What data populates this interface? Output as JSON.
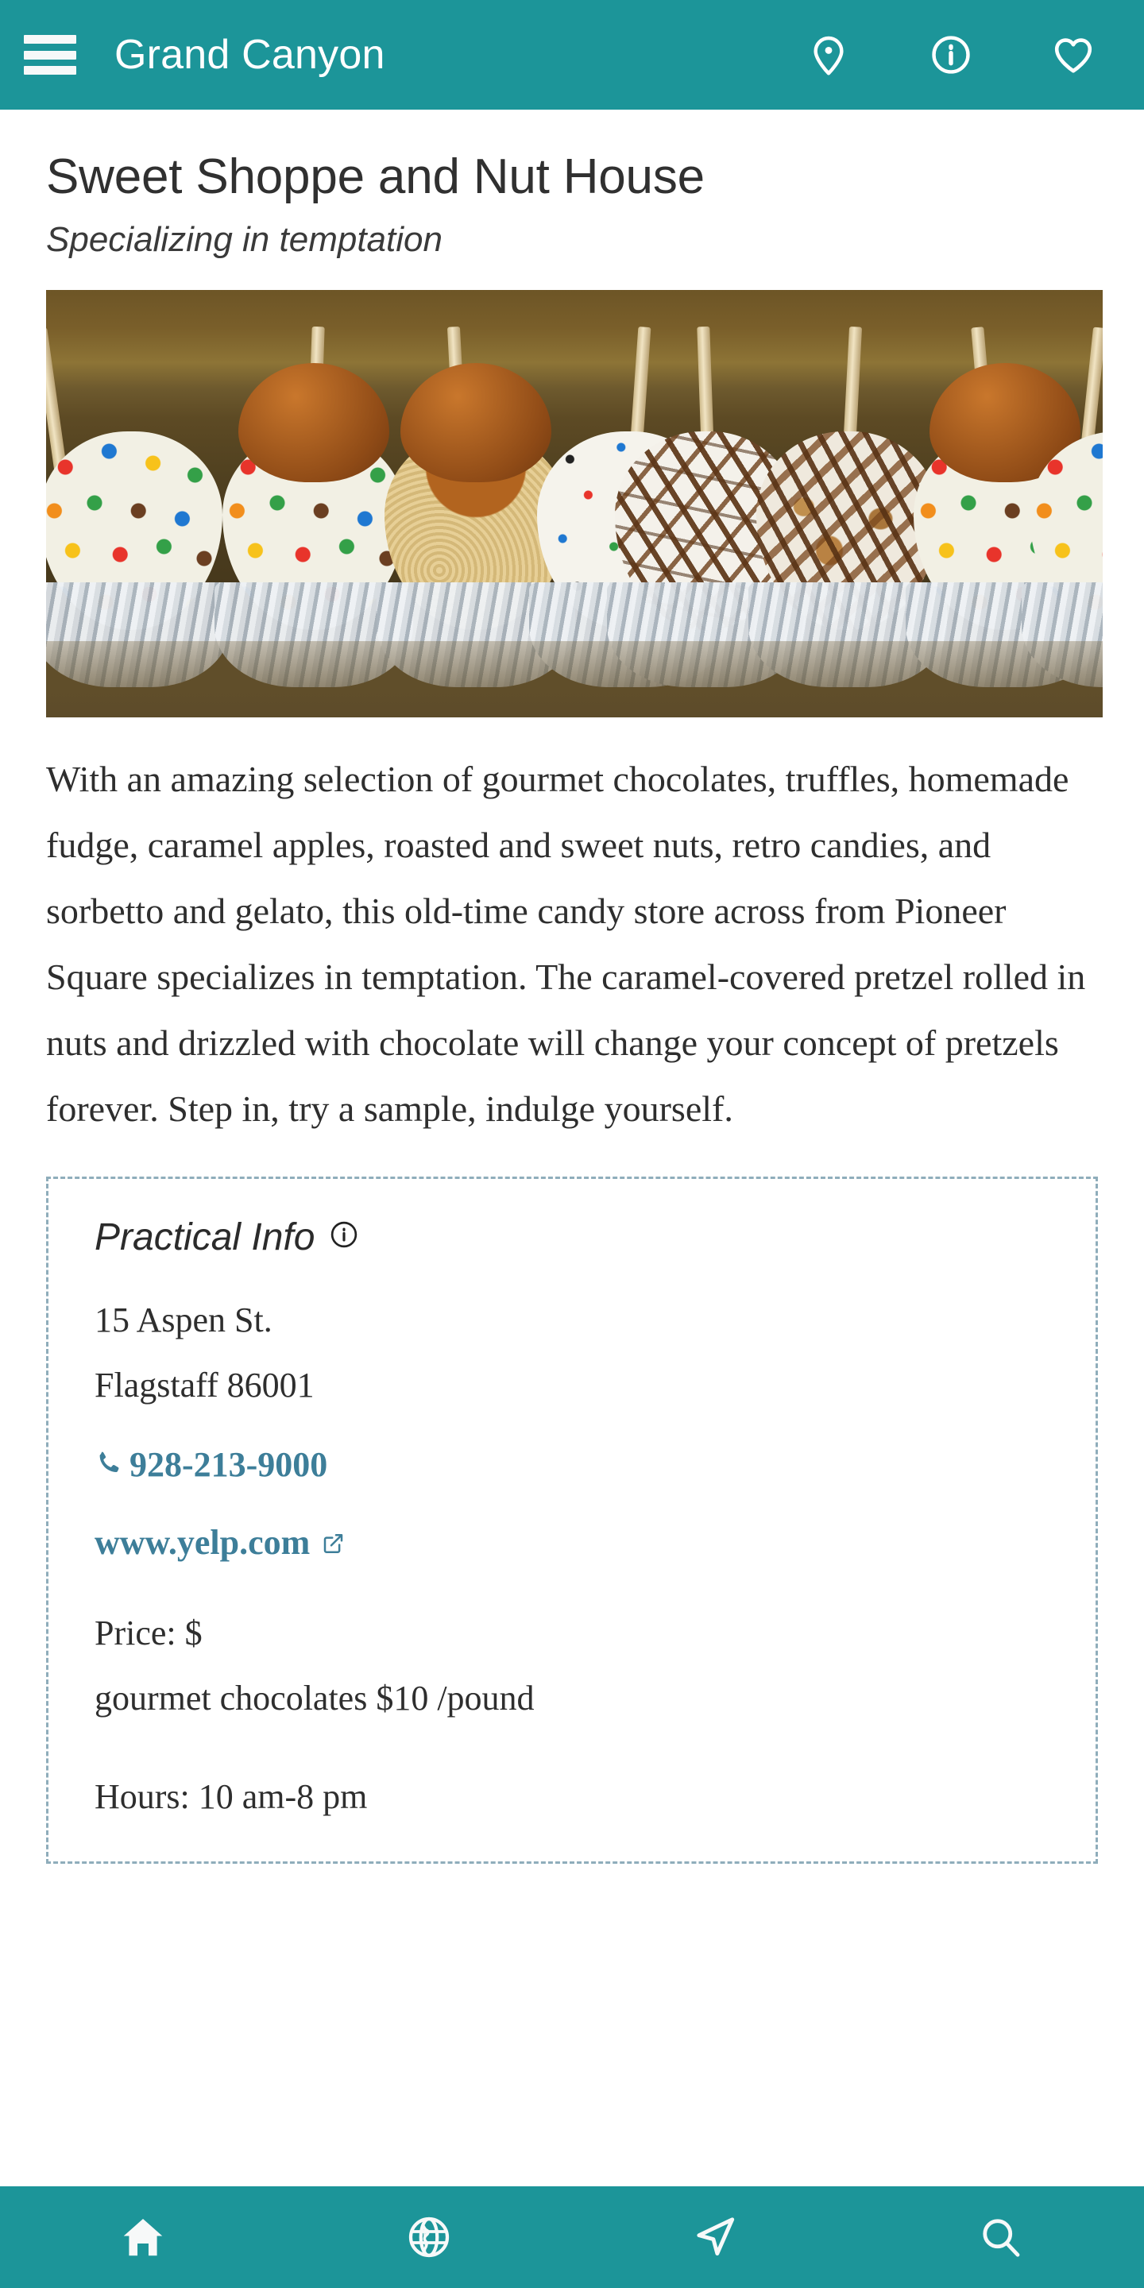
{
  "appbar": {
    "menu_icon": "hamburger-menu-icon",
    "title": "Grand Canyon",
    "actions": [
      {
        "name": "map-pin-icon",
        "label": "Map"
      },
      {
        "name": "info-circle-icon",
        "label": "Info"
      },
      {
        "name": "heart-icon",
        "label": "Favorite"
      }
    ]
  },
  "listing": {
    "title": "Sweet Shoppe and Nut House",
    "subtitle": "Specializing in temptation",
    "photo_alt": "Assorted gourmet caramel apples coated with candy, chocolate drizzle, nuts and sprinkles",
    "description": "With an amazing selection of gourmet chocolates, truffles, homemade fudge, caramel apples, roasted and sweet nuts, retro candies, and sorbetto and gelato, this old-time candy store across from Pioneer Square specializes in temptation. The caramel-covered pretzel rolled in nuts and drizzled with chocolate will change your concept of pretzels forever. Step in, try a sample, indulge yourself."
  },
  "practical_info": {
    "heading": "Practical Info",
    "heading_icon": "info-circle-icon",
    "address_line1": "15 Aspen St.",
    "address_line2": "Flagstaff 86001",
    "phone": "928-213-9000",
    "phone_icon": "phone-icon",
    "website": "www.yelp.com",
    "website_icon": "external-link-icon",
    "price_label": "Price: $",
    "price_detail": "gourmet chocolates $10 /pound",
    "hours": "Hours: 10 am-8 pm"
  },
  "bottomnav": {
    "items": [
      {
        "name": "home-icon",
        "label": "Home"
      },
      {
        "name": "globe-icon",
        "label": "Explore"
      },
      {
        "name": "navigate-icon",
        "label": "Navigate"
      },
      {
        "name": "search-icon",
        "label": "Search"
      }
    ]
  },
  "colors": {
    "brand_teal": "#1c9599",
    "link_blue": "#3d7e99",
    "dashed_border": "#8fadbb",
    "text_dark": "#2e2e2e"
  }
}
